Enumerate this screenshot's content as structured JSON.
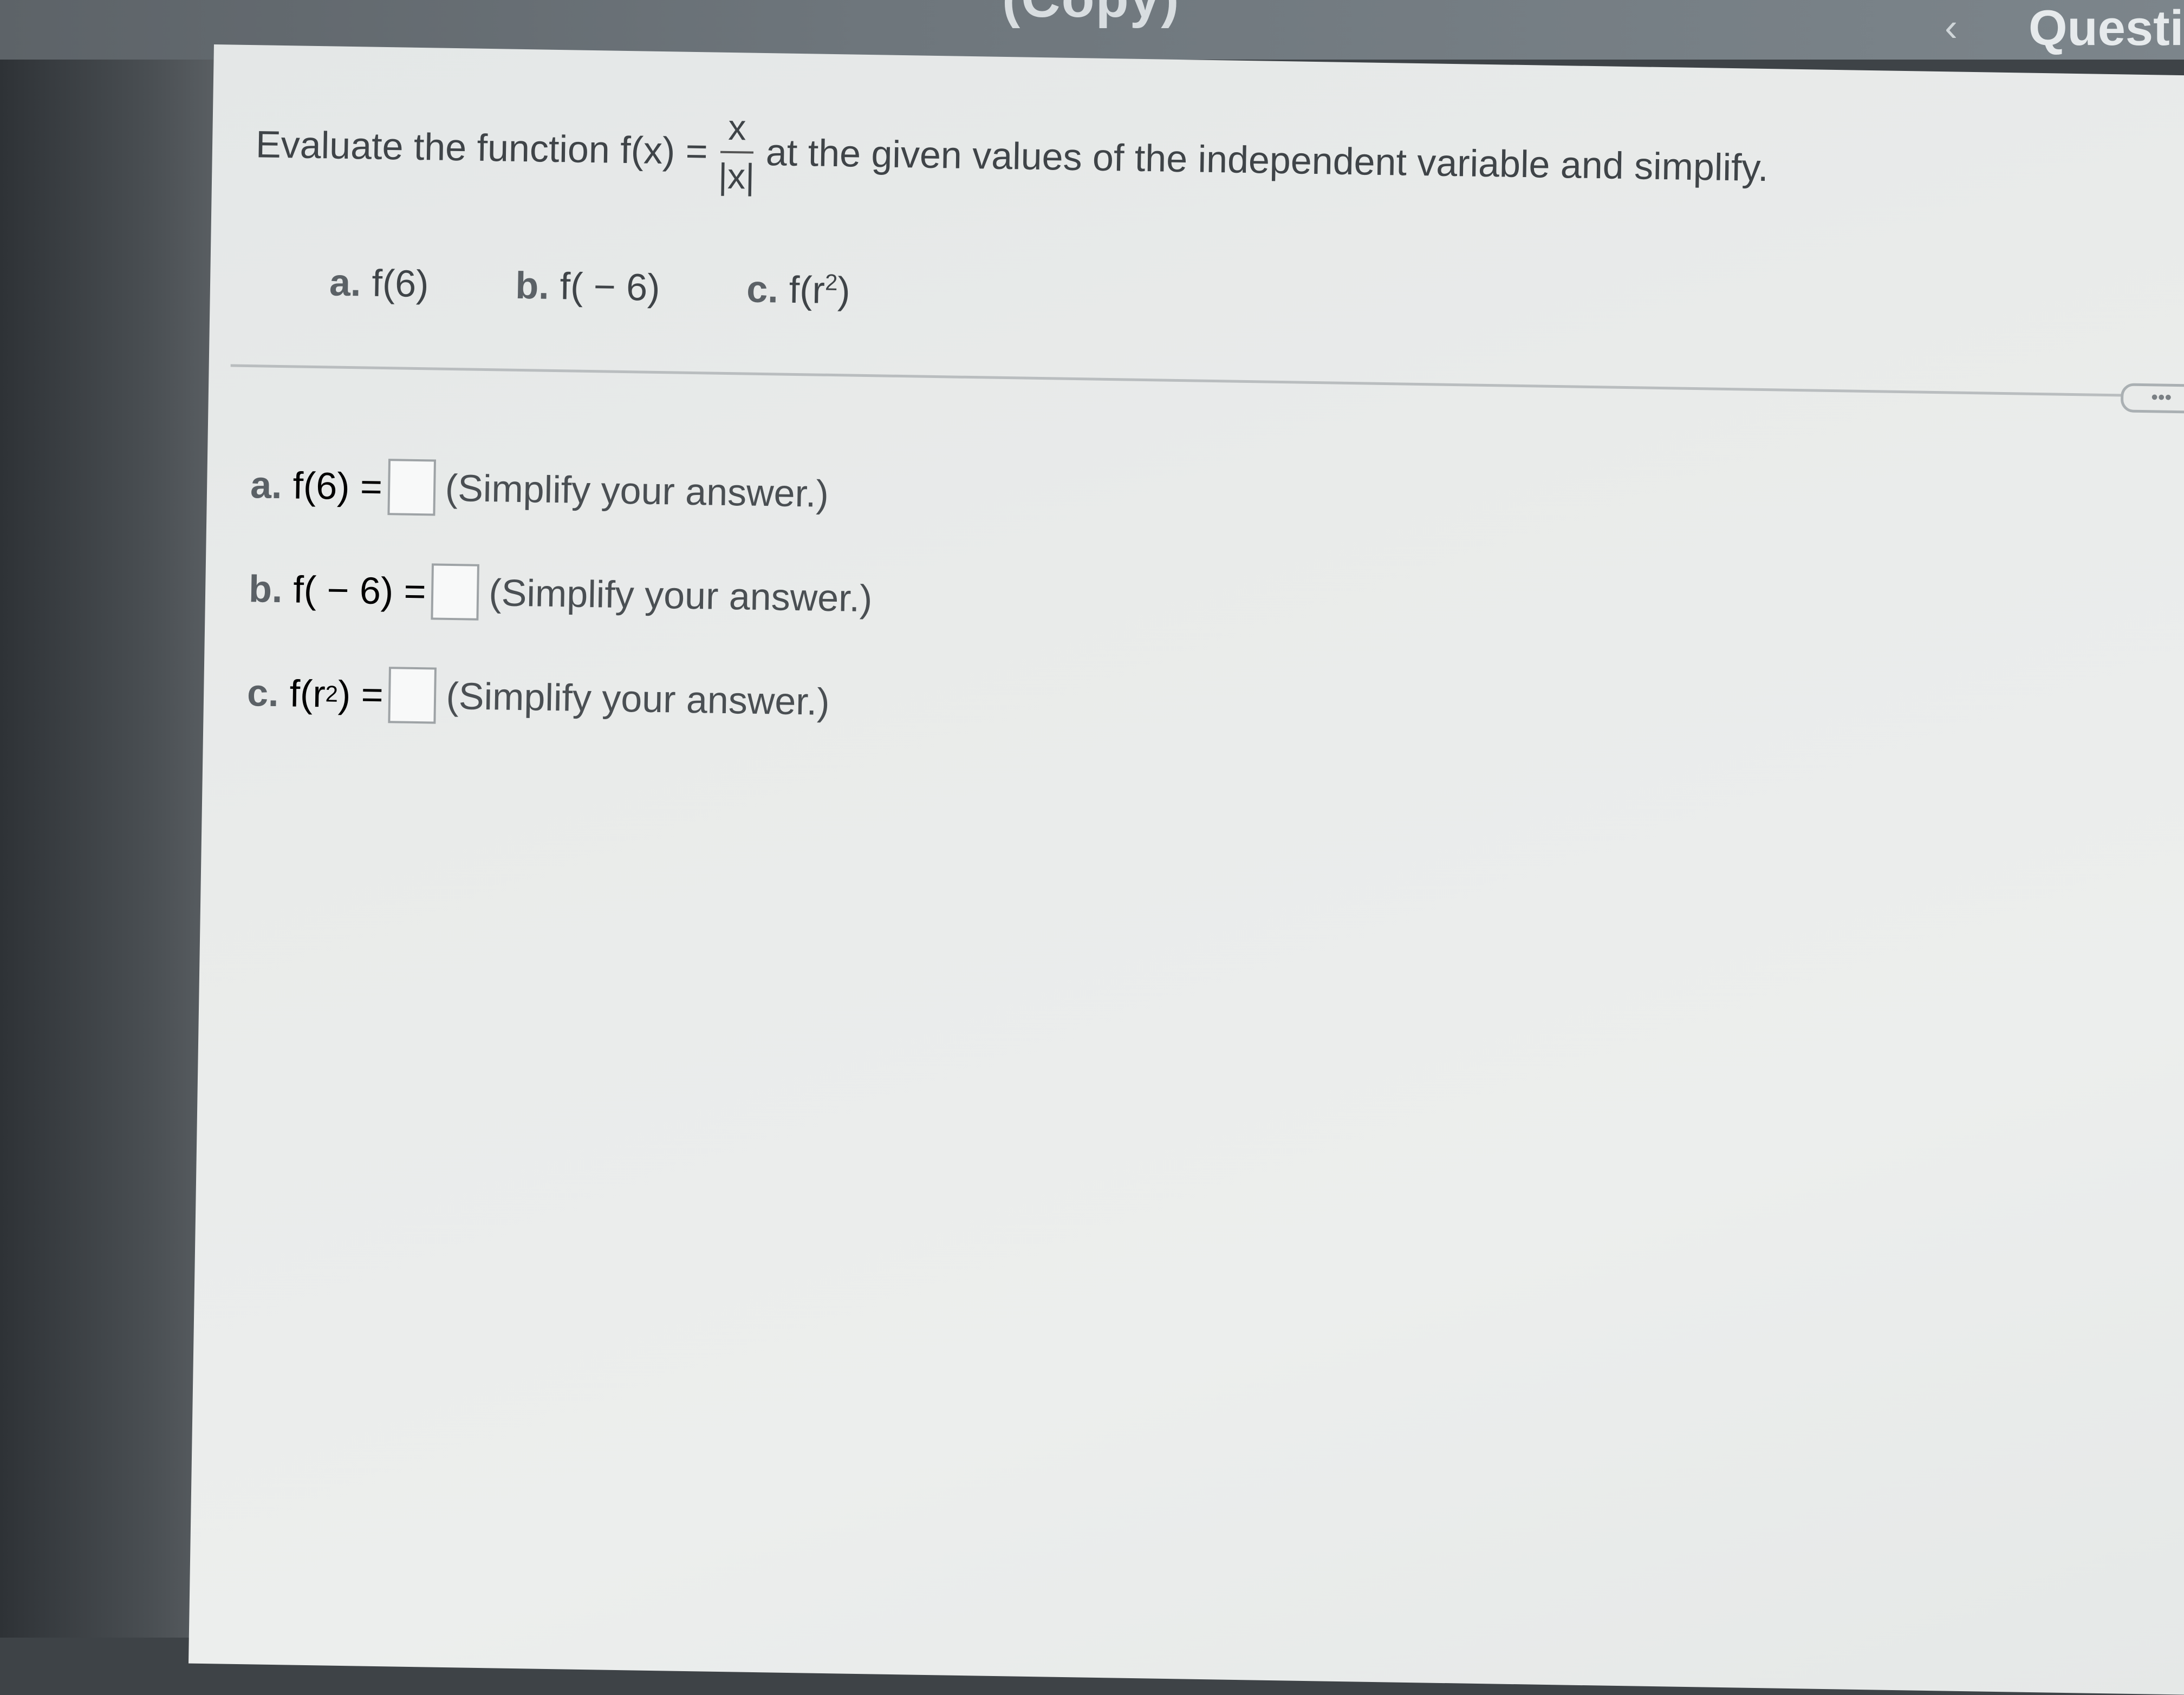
{
  "header": {
    "title": "(Copy)",
    "back_icon": "chevron-left-icon",
    "question_label": "Questio"
  },
  "prompt": {
    "before": "Evaluate the function f(x) =",
    "numerator": "x",
    "denominator": "|x|",
    "after": "at the given values of the independent variable and simplify."
  },
  "parts": [
    {
      "label": "a.",
      "expr": "f(6)"
    },
    {
      "label": "b.",
      "expr": "f( − 6)"
    },
    {
      "label": "c.",
      "expr_base": "f(r",
      "expr_sup": "2",
      "expr_end": ")"
    }
  ],
  "answers": [
    {
      "label": "a.",
      "expr": "f(6) =",
      "hint": "(Simplify your answer.)"
    },
    {
      "label": "b.",
      "expr": "f( − 6) =",
      "hint": "(Simplify your answer.)"
    },
    {
      "label": "c.",
      "expr_base": "f(r",
      "expr_sup": "2",
      "expr_end": ") =",
      "hint": "(Simplify your answer.)"
    }
  ],
  "more_button": "•••"
}
